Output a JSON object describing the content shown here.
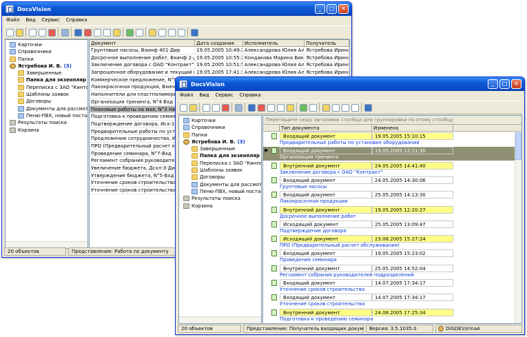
{
  "back_window": {
    "title": "DocsVision",
    "menu": [
      "Файл",
      "Вид",
      "Сервис",
      "Справка"
    ],
    "tree": [
      {
        "label": "Карточки",
        "icon": "cards-icon",
        "bold": false,
        "indent": 0
      },
      {
        "label": "Справочники",
        "icon": "directory-icon",
        "bold": false,
        "indent": 0
      },
      {
        "label": "Папки",
        "icon": "folder-icon",
        "bold": false,
        "indent": 0
      },
      {
        "label": "Ястребова И. В.",
        "count": "(3)",
        "icon": "user-icon",
        "bold": true,
        "indent": 0
      },
      {
        "label": "Завершенные",
        "icon": "folder-icon",
        "bold": false,
        "indent": 1
      },
      {
        "label": "Папка для экзенпляр",
        "icon": "folder-icon",
        "bold": true,
        "indent": 1
      },
      {
        "label": "Переписка с ЗАО \"Кинто",
        "icon": "folder-icon",
        "bold": false,
        "indent": 1
      },
      {
        "label": "Шаблоны заявок",
        "icon": "folder-icon",
        "bold": false,
        "indent": 1
      },
      {
        "label": "Договоры",
        "icon": "folder-icon",
        "bold": false,
        "indent": 1
      },
      {
        "label": "Документы для рассмот",
        "icon": "search-folder-icon",
        "bold": false,
        "indent": 1
      },
      {
        "label": "Пеню-ПВХ, новый постав",
        "icon": "search-folder-icon",
        "bold": false,
        "indent": 1
      },
      {
        "label": "Результаты поиска",
        "icon": "search-results-icon",
        "bold": false,
        "indent": 0
      },
      {
        "label": "Корзина",
        "icon": "trash-icon",
        "bold": false,
        "indent": 0
      }
    ],
    "columns": [
      "Документ",
      "Дата создания",
      "Исполнитель",
      "Получатель"
    ],
    "rows": [
      [
        "Грунтовые насосы, Вхинф 401-Дир",
        "19.05.2005 10:49:29",
        "Александрова Юлия Алекс...",
        "Ястребова Ирина Е"
      ],
      [
        "Досрочное выполнение работ, Вхинф 2-Дир",
        "19.05.2005 10:55:22",
        "Кондакова Марина Виктор...",
        "Ястребова Ирина Е"
      ],
      [
        "Заключение договора с ОАО \"Контракт\", Дог",
        "19.05.2005 10:51:56",
        "Александрова Юлия Алекс...",
        "Ястребова Ирина Е"
      ],
      [
        "Запрошенное оборудование и текущий прове",
        "19.05.2005 17:41:34",
        "Александрова Юлия Алекс...",
        "Ястребова Ирина Е"
      ],
      [
        "Коммерческое предложение, N°9 Вхд",
        "",
        "",
        ""
      ],
      [
        "Лакокрасочная продукция, Вхинф 403",
        "",
        "",
        ""
      ],
      [
        "Наполнители для пластполимеров, N°",
        "",
        "",
        ""
      ],
      [
        "Организация тренинга, N°4 Вхд",
        "",
        "",
        ""
      ],
      [
        "Плановые работы на мая, N°3 Нит",
        "",
        "",
        ""
      ],
      [
        "Подготовка к проведению семинара",
        "",
        "",
        ""
      ],
      [
        "Подтверждение договора, Исх-1-Дир",
        "",
        "",
        ""
      ],
      [
        "Предварительные работы по установ",
        "",
        "",
        ""
      ],
      [
        "Предложение сотрудничества, Исх-2-",
        "",
        "",
        ""
      ],
      [
        "ПРО (Предварительный расчет обслуж",
        "",
        "",
        ""
      ],
      [
        "Проведение семинара, N°7-Вхд",
        "",
        "",
        ""
      ],
      [
        "Регламент собрания руководителей п",
        "",
        "",
        ""
      ],
      [
        "Увеличение бюджета, Дсхл-3-Дир",
        "",
        "",
        ""
      ],
      [
        "Утверждение бюджета, N°5-Вхд",
        "",
        "",
        ""
      ],
      [
        "Уточнение сроков строительства, N°15",
        "",
        "",
        ""
      ],
      [
        "Уточнение сроков строительства, N°15",
        "",
        "",
        ""
      ]
    ],
    "selected_row": 8,
    "status": {
      "count": "20 объектов",
      "view": "Представление: Работа по документу"
    }
  },
  "front_window": {
    "title": "DocsVision",
    "menu": [
      "Файл",
      "Вид",
      "Сервис",
      "Справка"
    ],
    "tree": [
      {
        "label": "Карточки",
        "icon": "cards-icon",
        "bold": false,
        "indent": 0
      },
      {
        "label": "Справочники",
        "icon": "directory-icon",
        "bold": false,
        "indent": 0
      },
      {
        "label": "Папки",
        "icon": "folder-icon",
        "bold": false,
        "indent": 0
      },
      {
        "label": "Ястребова И. В.",
        "count": "(3)",
        "icon": "user-icon",
        "bold": true,
        "indent": 0
      },
      {
        "label": "Завершенные",
        "icon": "folder-icon",
        "bold": false,
        "indent": 1
      },
      {
        "label": "Папка для экзенпляр",
        "icon": "folder-icon",
        "bold": true,
        "indent": 1
      },
      {
        "label": "Переписка с ЗАО \"Кинпо",
        "icon": "folder-icon",
        "bold": false,
        "indent": 1
      },
      {
        "label": "Шаблоны заявок",
        "icon": "folder-icon",
        "bold": false,
        "indent": 1
      },
      {
        "label": "Договоры",
        "icon": "folder-icon",
        "bold": false,
        "indent": 1
      },
      {
        "label": "Документы для рассмот",
        "icon": "search-folder-icon",
        "bold": false,
        "indent": 1
      },
      {
        "label": "Пеню-ПВХ, новый постав",
        "icon": "search-folder-icon",
        "bold": false,
        "indent": 1
      },
      {
        "label": "Результаты поиска",
        "icon": "search-results-icon",
        "bold": false,
        "indent": 0
      },
      {
        "label": "Корзина",
        "icon": "trash-icon",
        "bold": false,
        "indent": 0
      }
    ],
    "group_hint": "Перетащите сюда заголовок столбца для группировки по этому столбцу",
    "columns": [
      "Тип документа",
      "Изменена"
    ],
    "records": [
      {
        "type": "Входящий документ",
        "date": "19.05.2005 15:10:15",
        "desc": "Предварительные работы по установке оборудования",
        "style": "y",
        "indicator": ""
      },
      {
        "type": "Входящий документ",
        "date": "19.05.2005 12:21:30",
        "desc": "Организация тренинга",
        "style": "g",
        "indicator": "▶"
      },
      {
        "type": "Внутренний документ",
        "date": "24.05.2005 14:41:40",
        "desc": "Заключение договора с ОАО \"Контракт\"",
        "style": "y",
        "indicator": ""
      },
      {
        "type": "Входящий документ",
        "date": "24.05.2005 14:30:06",
        "desc": "Грунтовые насосы",
        "style": "w",
        "indicator": ""
      },
      {
        "type": "Входящий документ",
        "date": "25.05.2005 14:13:30",
        "desc": "Лакокрасочная продукция",
        "style": "w",
        "indicator": ""
      },
      {
        "type": "Внутренний документ",
        "date": "19.05.2005 12:20:27",
        "desc": "Досрочное выполнение работ",
        "style": "y",
        "indicator": ""
      },
      {
        "type": "Исходящий документ",
        "date": "25.05.2005 13:09:47",
        "desc": "Подтверждение договора",
        "style": "w",
        "indicator": ""
      },
      {
        "type": "Исходящий документ",
        "date": "23.08.2005 15:27:24",
        "desc": "ПРО (Предварительный расчет обслуживания)",
        "style": "y",
        "indicator": ""
      },
      {
        "type": "Входящий документ",
        "date": "19.05.2005 15:23:02",
        "desc": "Проведение семинара",
        "style": "w",
        "indicator": ""
      },
      {
        "type": "Внутренний документ",
        "date": "25.05.2005 14:52:04",
        "desc": "Регламент собрания руководителей подразделений",
        "style": "w",
        "indicator": ""
      },
      {
        "type": "Входящий документ",
        "date": "14.07.2005 17:34:17",
        "desc": "Уточнение сроков строительства",
        "style": "w",
        "indicator": ""
      },
      {
        "type": "Входящий документ",
        "date": "14.07.2005 17:34:17",
        "desc": "Уточнение сроков строительства",
        "style": "w",
        "indicator": ""
      },
      {
        "type": "Внутренний документ",
        "date": "24.08.2005 17:25:34",
        "desc": "Подготовка к проведению семинара",
        "style": "y",
        "indicator": ""
      }
    ],
    "status": {
      "count": "20 объектов",
      "view": "Представление: Получатель входящих документов",
      "version": "Версия: 3.5.1035.0",
      "user": "DIGDES\\IrinaA"
    }
  }
}
